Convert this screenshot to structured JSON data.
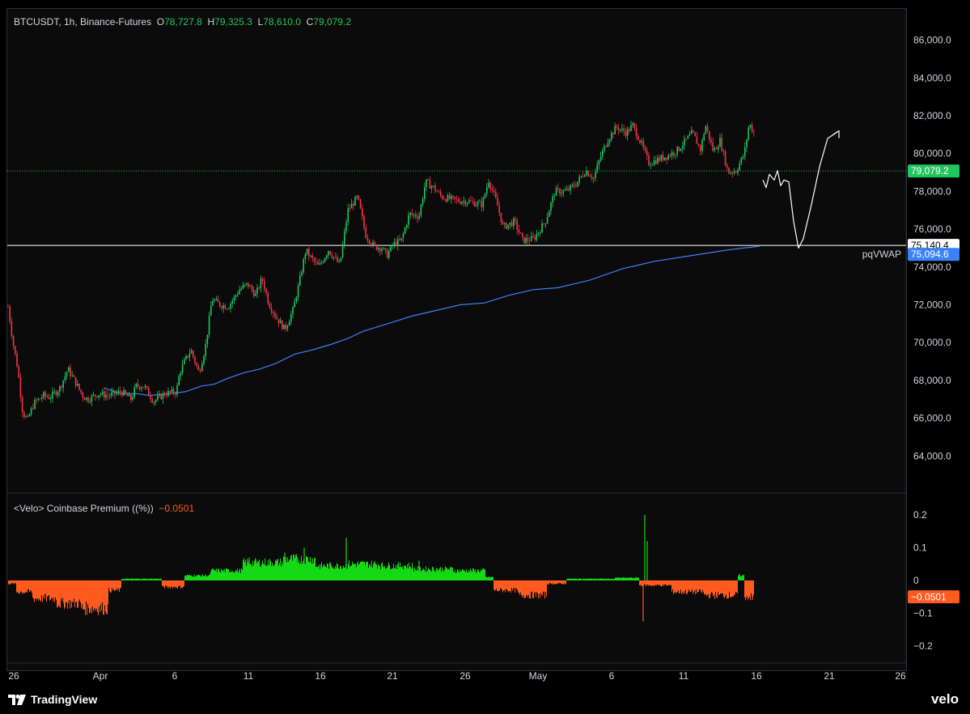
{
  "header": {
    "symbol": "BTCUSDT, 1h, Binance-Futures",
    "open_label": "O",
    "open": "78,727.8",
    "high_label": "H",
    "high": "79,325.3",
    "low_label": "L",
    "low": "78,610.0",
    "close_label": "C",
    "close": "79,079.2"
  },
  "indicator": {
    "name": "<Velo> Coinbase Premium ((%))",
    "value": "−0.0501"
  },
  "footer": {
    "brand": "TradingView",
    "velo": "velo"
  },
  "colors": {
    "up": "#22c55e",
    "down": "#f23645",
    "premium_pos": "#16d916",
    "premium_neg": "#ff5a1f",
    "vwap": "#3b82f6",
    "background": "#0b0b0b"
  },
  "chart_data": [
    {
      "type": "candlestick",
      "title": "BTCUSDT, 1h, Binance-Futures",
      "x_tick_labels": [
        "26",
        "Apr",
        "6",
        "11",
        "16",
        "21",
        "26",
        "May",
        "6",
        "11",
        "16",
        "21",
        "26"
      ],
      "y_tick_labels": [
        "64,000.0",
        "66,000.0",
        "68,000.0",
        "70,000.0",
        "72,000.0",
        "74,000.0",
        "76,000.0",
        "78,000.0",
        "80,000.0",
        "82,000.0",
        "84,000.0",
        "86,000.0"
      ],
      "ylim": [
        62000,
        87500
      ],
      "price_path": [
        [
          0,
          71900
        ],
        [
          6,
          70000
        ],
        [
          12,
          68600
        ],
        [
          18,
          66300
        ],
        [
          24,
          65900
        ],
        [
          32,
          66800
        ],
        [
          44,
          67200
        ],
        [
          52,
          67100
        ],
        [
          64,
          67600
        ],
        [
          74,
          68600
        ],
        [
          82,
          68000
        ],
        [
          92,
          67200
        ],
        [
          98,
          67000
        ],
        [
          112,
          67300
        ],
        [
          124,
          67200
        ],
        [
          140,
          67400
        ],
        [
          152,
          67000
        ],
        [
          158,
          67700
        ],
        [
          168,
          67700
        ],
        [
          180,
          66900
        ],
        [
          194,
          67300
        ],
        [
          208,
          67400
        ],
        [
          212,
          68400
        ],
        [
          218,
          69000
        ],
        [
          226,
          69600
        ],
        [
          236,
          68400
        ],
        [
          244,
          69800
        ],
        [
          252,
          72300
        ],
        [
          262,
          72000
        ],
        [
          272,
          71900
        ],
        [
          286,
          72800
        ],
        [
          296,
          73100
        ],
        [
          306,
          72500
        ],
        [
          314,
          73400
        ],
        [
          322,
          72100
        ],
        [
          332,
          71300
        ],
        [
          342,
          70700
        ],
        [
          352,
          71700
        ],
        [
          360,
          73200
        ],
        [
          368,
          74900
        ],
        [
          374,
          74500
        ],
        [
          384,
          74000
        ],
        [
          396,
          74900
        ],
        [
          410,
          74100
        ],
        [
          420,
          77000
        ],
        [
          432,
          77700
        ],
        [
          442,
          75700
        ],
        [
          452,
          75100
        ],
        [
          462,
          75000
        ],
        [
          468,
          74600
        ],
        [
          476,
          75200
        ],
        [
          486,
          75400
        ],
        [
          496,
          76800
        ],
        [
          508,
          76700
        ],
        [
          516,
          78500
        ],
        [
          526,
          78200
        ],
        [
          536,
          77700
        ],
        [
          546,
          77600
        ],
        [
          556,
          77500
        ],
        [
          566,
          77500
        ],
        [
          576,
          77400
        ],
        [
          586,
          77300
        ],
        [
          594,
          78600
        ],
        [
          604,
          77400
        ],
        [
          612,
          76100
        ],
        [
          626,
          76400
        ],
        [
          636,
          75400
        ],
        [
          650,
          75500
        ],
        [
          664,
          76400
        ],
        [
          676,
          78000
        ],
        [
          690,
          78000
        ],
        [
          702,
          78400
        ],
        [
          714,
          79100
        ],
        [
          724,
          78700
        ],
        [
          732,
          79800
        ],
        [
          742,
          80800
        ],
        [
          752,
          81400
        ],
        [
          764,
          81100
        ],
        [
          772,
          81500
        ],
        [
          782,
          80600
        ],
        [
          792,
          79500
        ],
        [
          804,
          79700
        ],
        [
          816,
          79900
        ],
        [
          828,
          80200
        ],
        [
          838,
          80700
        ],
        [
          846,
          81100
        ],
        [
          856,
          80200
        ],
        [
          862,
          81500
        ],
        [
          872,
          80100
        ],
        [
          880,
          80700
        ],
        [
          890,
          79000
        ],
        [
          900,
          79100
        ],
        [
          910,
          80000
        ],
        [
          916,
          81600
        ],
        [
          924,
          80900
        ],
        [
          930,
          79100
        ]
      ],
      "close_line": {
        "value": 79079.2,
        "label": "79,079.2"
      },
      "horizontal_line": {
        "value": 75140.4,
        "label": "75,140.4"
      },
      "vwap_series": {
        "name": "pqVWAP",
        "value_label": "75,094.6",
        "points": [
          [
            120,
            67600
          ],
          [
            140,
            67300
          ],
          [
            160,
            67300
          ],
          [
            176,
            67200
          ],
          [
            200,
            67300
          ],
          [
            220,
            67400
          ],
          [
            240,
            67700
          ],
          [
            256,
            67800
          ],
          [
            272,
            68100
          ],
          [
            292,
            68400
          ],
          [
            312,
            68600
          ],
          [
            332,
            68900
          ],
          [
            356,
            69400
          ],
          [
            376,
            69600
          ],
          [
            400,
            69900
          ],
          [
            420,
            70200
          ],
          [
            440,
            70600
          ],
          [
            470,
            71000
          ],
          [
            500,
            71400
          ],
          [
            530,
            71700
          ],
          [
            560,
            72000
          ],
          [
            590,
            72100
          ],
          [
            620,
            72500
          ],
          [
            650,
            72800
          ],
          [
            680,
            72900
          ],
          [
            700,
            73100
          ],
          [
            720,
            73300
          ],
          [
            740,
            73600
          ],
          [
            760,
            73900
          ],
          [
            780,
            74100
          ],
          [
            800,
            74300
          ],
          [
            830,
            74500
          ],
          [
            860,
            74700
          ],
          [
            890,
            74900
          ],
          [
            910,
            75000
          ],
          [
            930,
            75100
          ]
        ]
      },
      "projection_path": [
        [
          934,
          78600
        ],
        [
          938,
          78200
        ],
        [
          942,
          78900
        ],
        [
          948,
          78600
        ],
        [
          952,
          79100
        ],
        [
          956,
          78300
        ],
        [
          960,
          78600
        ],
        [
          966,
          78500
        ],
        [
          972,
          76400
        ],
        [
          978,
          75000
        ],
        [
          984,
          75500
        ],
        [
          994,
          77300
        ],
        [
          1004,
          79300
        ],
        [
          1014,
          80800
        ],
        [
          1028,
          81200
        ]
      ]
    },
    {
      "type": "bar",
      "title": "<Velo> Coinbase Premium ((%))",
      "y_tick_labels": [
        "0.2",
        "0.1",
        "0",
        "−0.1",
        "−0.2"
      ],
      "ylim": [
        -0.25,
        0.25
      ],
      "current_value": -0.0501,
      "current_label": "−0.0501",
      "segments": [
        {
          "x_from": 10,
          "x_to": 20,
          "value": -0.01
        },
        {
          "x_from": 20,
          "x_to": 40,
          "value": -0.035
        },
        {
          "x_from": 40,
          "x_to": 70,
          "value": -0.055
        },
        {
          "x_from": 70,
          "x_to": 100,
          "value": -0.07
        },
        {
          "x_from": 100,
          "x_to": 134,
          "value": -0.085
        },
        {
          "x_from": 134,
          "x_to": 150,
          "value": -0.03
        },
        {
          "x_from": 150,
          "x_to": 200,
          "value": 0.005
        },
        {
          "x_from": 200,
          "x_to": 228,
          "value": -0.02
        },
        {
          "x_from": 228,
          "x_to": 260,
          "value": 0.015
        },
        {
          "x_from": 260,
          "x_to": 300,
          "value": 0.03
        },
        {
          "x_from": 300,
          "x_to": 350,
          "value": 0.055
        },
        {
          "x_from": 350,
          "x_to": 390,
          "value": 0.065
        },
        {
          "x_from": 390,
          "x_to": 430,
          "value": 0.045
        },
        {
          "x_from": 430,
          "x_to": 470,
          "value": 0.05
        },
        {
          "x_from": 470,
          "x_to": 510,
          "value": 0.045
        },
        {
          "x_from": 510,
          "x_to": 560,
          "value": 0.035
        },
        {
          "x_from": 560,
          "x_to": 600,
          "value": 0.03
        },
        {
          "x_from": 600,
          "x_to": 610,
          "value": 0.01
        },
        {
          "x_from": 610,
          "x_to": 640,
          "value": -0.03
        },
        {
          "x_from": 640,
          "x_to": 676,
          "value": -0.045
        },
        {
          "x_from": 676,
          "x_to": 700,
          "value": -0.01
        },
        {
          "x_from": 700,
          "x_to": 760,
          "value": 0.005
        },
        {
          "x_from": 760,
          "x_to": 790,
          "value": 0.008
        },
        {
          "x_from": 790,
          "x_to": 830,
          "value": -0.015
        },
        {
          "x_from": 830,
          "x_to": 870,
          "value": -0.035
        },
        {
          "x_from": 870,
          "x_to": 912,
          "value": -0.045
        },
        {
          "x_from": 912,
          "x_to": 920,
          "value": 0.015
        },
        {
          "x_from": 920,
          "x_to": 932,
          "value": -0.05
        }
      ],
      "spikes": [
        {
          "x": 308,
          "value": 0.07
        },
        {
          "x": 352,
          "value": 0.085
        },
        {
          "x": 376,
          "value": 0.1
        },
        {
          "x": 428,
          "value": 0.13
        },
        {
          "x": 518,
          "value": 0.06
        },
        {
          "x": 797,
          "value": 0.2
        },
        {
          "x": 800,
          "value": 0.12
        },
        {
          "x": 795,
          "value": -0.125
        },
        {
          "x": 930,
          "value": -0.06
        }
      ]
    }
  ]
}
